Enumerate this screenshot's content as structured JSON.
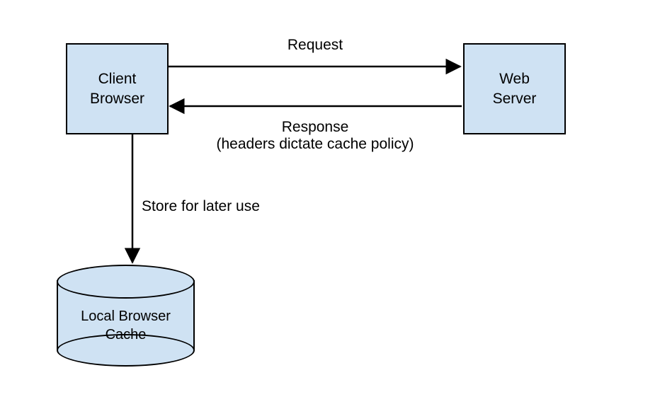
{
  "nodes": {
    "client": "Client\nBrowser",
    "server": "Web\nServer",
    "cache": "Local Browser\nCache"
  },
  "edges": {
    "request": "Request",
    "response_line1": "Response",
    "response_line2": "(headers dictate cache policy)",
    "store": "Store for later use"
  }
}
